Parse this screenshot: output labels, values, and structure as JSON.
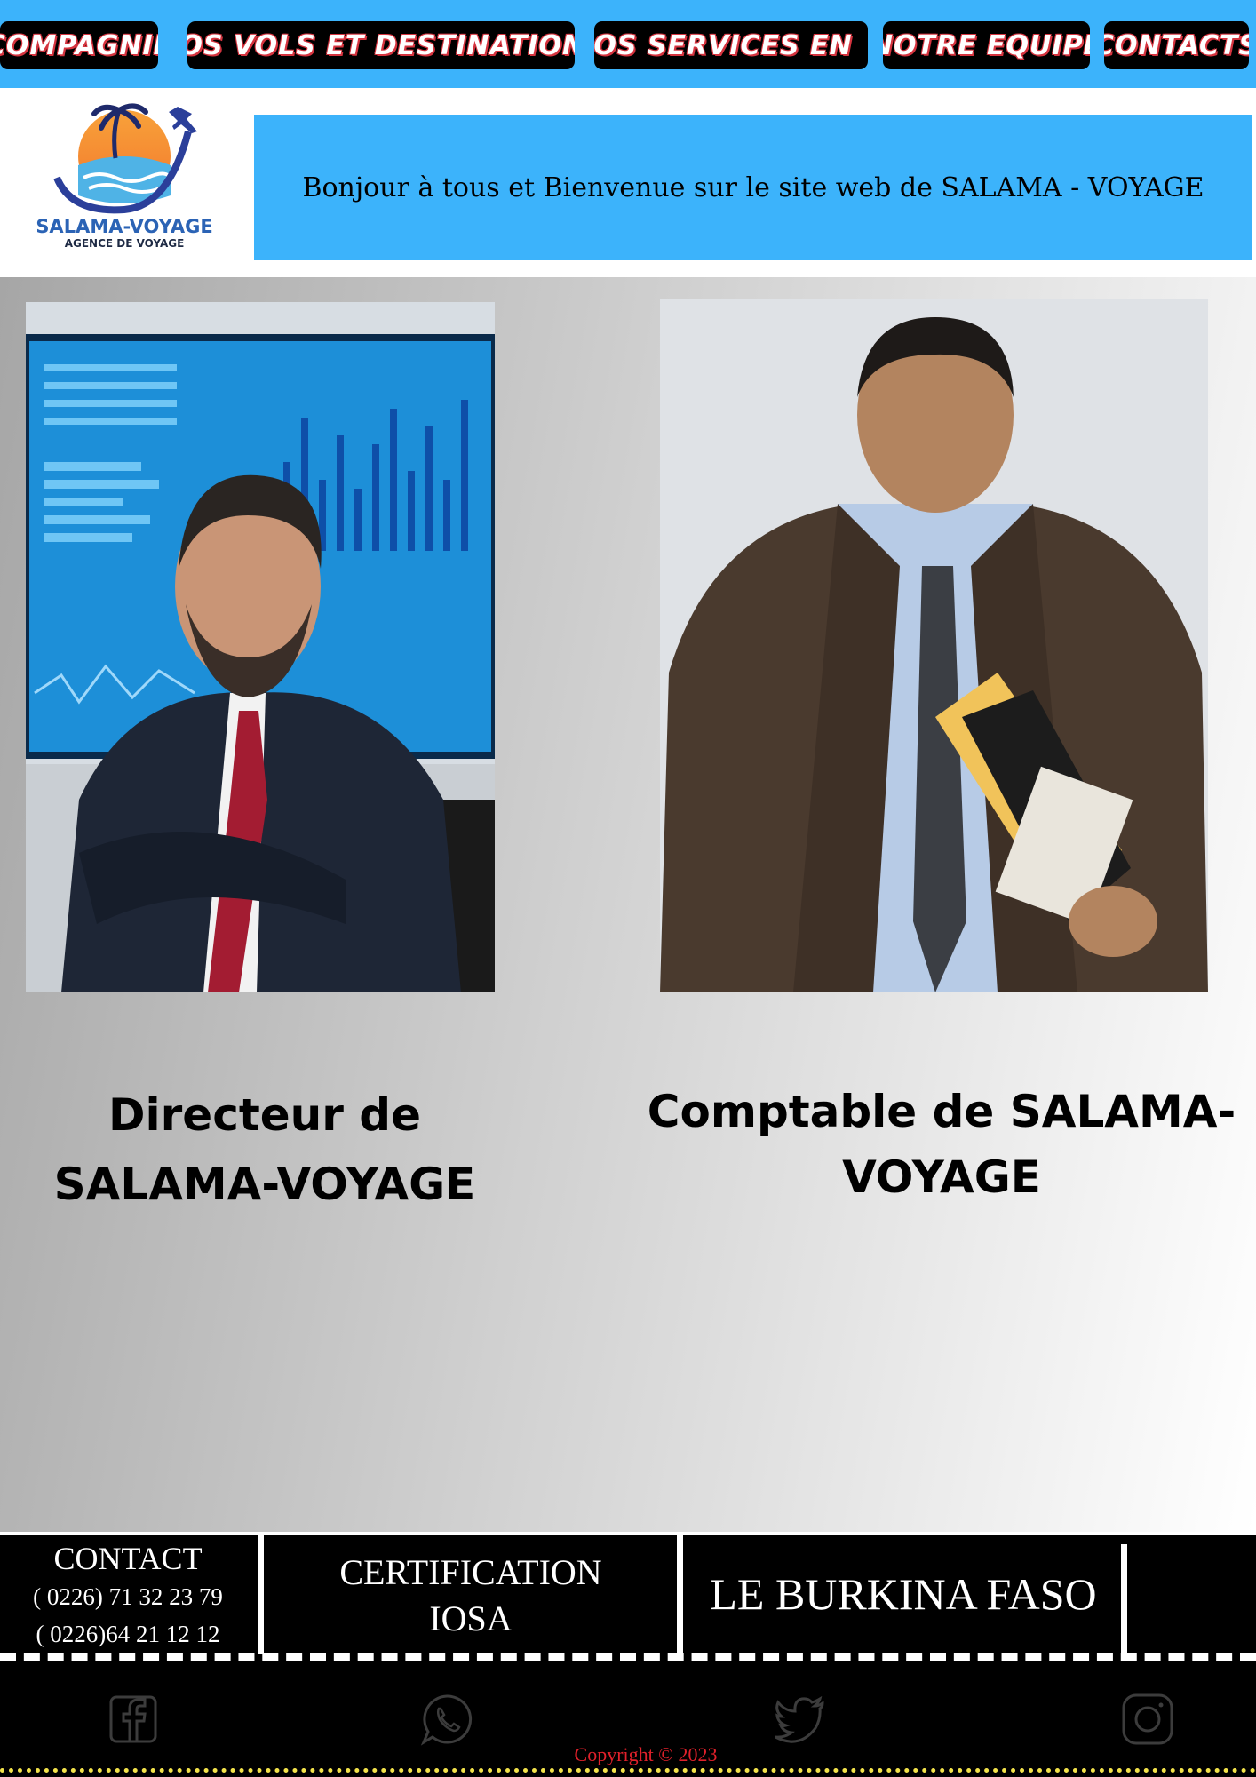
{
  "nav": {
    "items": [
      {
        "label": "COMPAGNIE"
      },
      {
        "label": "NOS VOLS ET DESTINATIONS"
      },
      {
        "label": "NOS SERVICES EN",
        "suffix": "+"
      },
      {
        "label": "NOTRE EQUIPE"
      },
      {
        "label": "CONTACTS"
      }
    ]
  },
  "header": {
    "logo_name": "SALAMA-VOYAGE",
    "logo_subtitle": "AGENCE DE VOYAGE",
    "welcome": "Bonjour à tous et Bienvenue sur le site web de SALAMA - VOYAGE"
  },
  "team": [
    {
      "title_line1": "Directeur de",
      "title_line2": "SALAMA-VOYAGE"
    },
    {
      "title_line1": "Comptable de SALAMA-",
      "title_line2": "VOYAGE"
    }
  ],
  "footer": {
    "contact_heading": "CONTACT",
    "phone1": "( 0226) 71 32 23 79",
    "phone2": "( 0226)64 21 12 12",
    "certification_line1": "CERTIFICATION",
    "certification_line2": "IOSA",
    "country": "LE BURKINA FASO",
    "copyright": "Copyright © 2023",
    "social_icons": [
      "facebook-icon",
      "whatsapp-icon",
      "twitter-icon",
      "instagram-icon"
    ]
  },
  "colors": {
    "brand_blue": "#3cb3fb",
    "nav_text_outline": "#d5343f",
    "copyright_red": "#e0212b",
    "logo_blue": "#2b63b5"
  }
}
